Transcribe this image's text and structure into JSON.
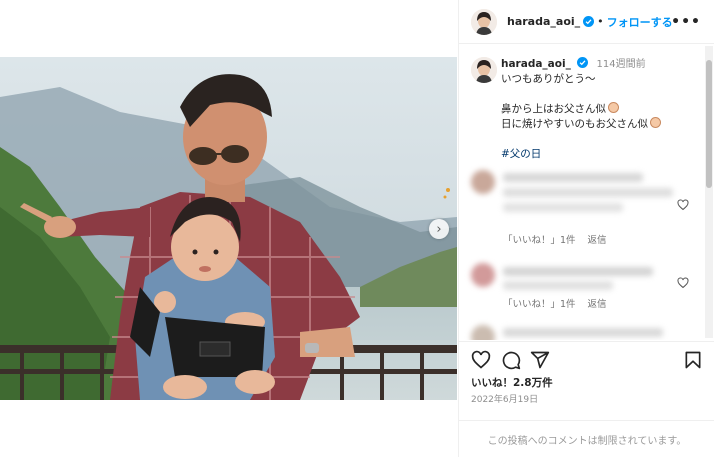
{
  "post": {
    "username": "harada_aoi_",
    "follow_label": "フォローする",
    "separator": "•",
    "more_label": "•••"
  },
  "caption": {
    "username": "harada_aoi_",
    "timestamp": "114週間前",
    "lines": [
      "いつもありがとう～",
      "鼻から上はお父さん似",
      "日に焼けやすいのもお父さん似"
    ],
    "hashtag": "#父の日"
  },
  "comments": [
    {
      "likes_label": "「いいね！」1件",
      "reply_label": "返信"
    },
    {
      "likes_label": "「いいね！」1件",
      "reply_label": "返信"
    }
  ],
  "stats": {
    "likes": "いいね！2.8万件",
    "date": "2022年6月19日"
  },
  "footer": {
    "comments_disabled": "この投稿へのコメントは制限されています。"
  },
  "icons": {
    "like": "heart-icon",
    "comment": "comment-icon",
    "share": "share-icon",
    "save": "bookmark-icon",
    "next": "chevron-right-icon"
  },
  "colors": {
    "link_blue": "#0095f6",
    "verified_blue": "#0095f6",
    "hashtag": "#00376b"
  }
}
